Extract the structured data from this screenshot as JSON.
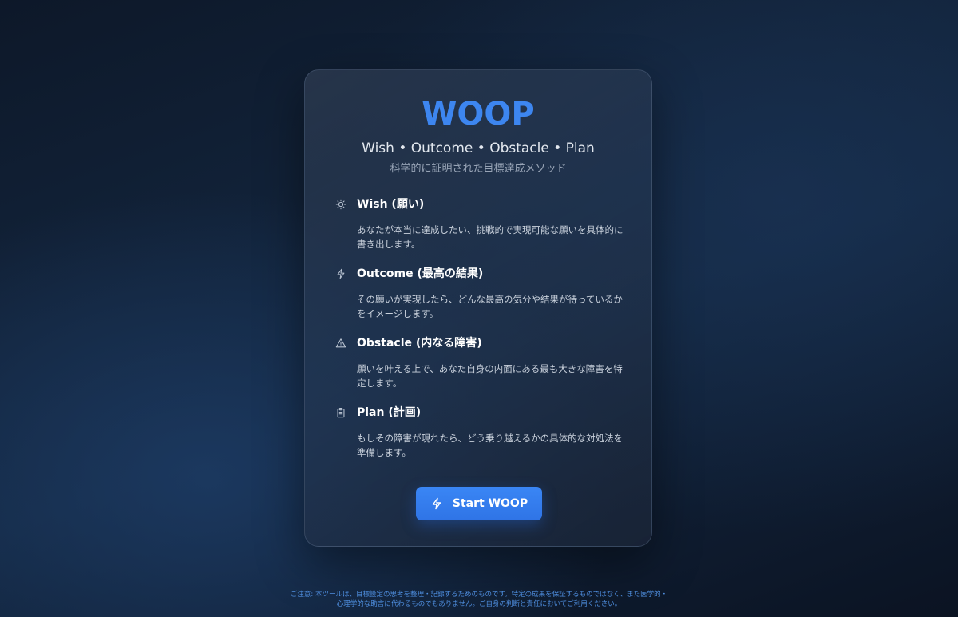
{
  "card": {
    "title": "WOOP",
    "subtitle": "Wish • Outcome • Obstacle • Plan",
    "tagline": "科学的に証明された目標達成メソッド"
  },
  "steps": [
    {
      "icon": "lightbulb-icon",
      "title": "Wish (願い)",
      "description": "あなたが本当に達成したい、挑戦的で実現可能な願いを具体的に書き出します。"
    },
    {
      "icon": "lightning-icon",
      "title": "Outcome (最高の結果)",
      "description": "その願いが実現したら、どんな最高の気分や結果が待っているかをイメージします。"
    },
    {
      "icon": "warning-triangle-icon",
      "title": "Obstacle (内なる障害)",
      "description": "願いを叶える上で、あなた自身の内面にある最も大きな障害を特定します。"
    },
    {
      "icon": "clipboard-icon",
      "title": "Plan (計画)",
      "description": "もしその障害が現れたら、どう乗り越えるかの具体的な対処法を準備します。"
    }
  ],
  "start_button": {
    "icon": "lightning-icon",
    "label": "Start WOOP"
  },
  "footer": {
    "line1": "ご注意: 本ツールは、目標設定の思考を整理・記録するためのものです。特定の成果を保証するものではなく、また医学的・",
    "line2": "心理学的な助言に代わるものでもありません。ご自身の判断と責任においてご利用ください。"
  },
  "colors": {
    "accent": "#3d86f0",
    "button": "#2f74e6",
    "footer_text": "#4f8fe0"
  }
}
